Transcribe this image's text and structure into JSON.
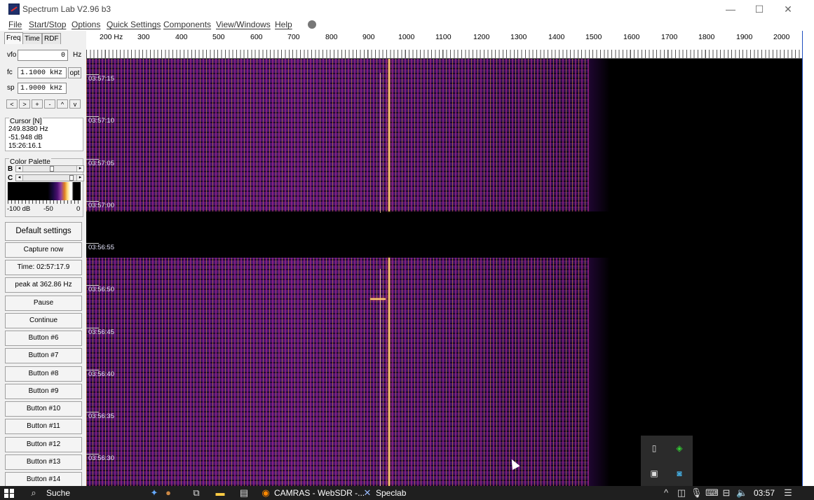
{
  "window": {
    "title": "Spectrum Lab V2.96 b3",
    "minimize": "—",
    "maximize": "☐",
    "close": "✕"
  },
  "menu": {
    "items": [
      "File",
      "Start/Stop",
      "Options",
      "Quick Settings",
      "Components",
      "View/Windows",
      "Help"
    ]
  },
  "tabs": [
    "Freq",
    "Time",
    "RDF"
  ],
  "vfo": {
    "label": "vfo",
    "value": "0",
    "unit": "Hz"
  },
  "fc": {
    "label": "fc",
    "value": "1.1000 kHz",
    "opt": "opt"
  },
  "sp": {
    "label": "sp",
    "value": "1.9000 kHz"
  },
  "nav_buttons": [
    "<",
    ">",
    "+",
    "-",
    "^",
    "v"
  ],
  "cursor": {
    "title": "Cursor [N]",
    "freq": "249.8380 Hz",
    "level": "-51.948 dB",
    "time": "15:26:16.1"
  },
  "palette": {
    "title": "Color Palette",
    "b_label": "B",
    "c_label": "C",
    "min": "-100 dB",
    "mid": "-50",
    "max": "0"
  },
  "buttons": [
    "Default settings",
    "Capture now",
    "Time:  02:57:17.9",
    "peak at 362.86 Hz",
    "Pause",
    "Continue",
    "Button #6",
    "Button #7",
    "Button #8",
    "Button #9",
    "Button #10",
    "Button #11",
    "Button #12",
    "Button #13",
    "Button #14"
  ],
  "freq_scale": [
    "200 Hz",
    "300",
    "400",
    "500",
    "600",
    "700",
    "800",
    "900",
    "1000",
    "1100",
    "1200",
    "1300",
    "1400",
    "1500",
    "1600",
    "1700",
    "1800",
    "1900",
    "2000"
  ],
  "time_labels": [
    "03:57:15",
    "03:57:10",
    "03:57:05",
    "03:57:00",
    "03:56:55",
    "03:56:50",
    "03:56:45",
    "03:56:40",
    "03:56:35",
    "03:56:30"
  ],
  "taskbar": {
    "search": "Suche",
    "app1": "CAMRAS - WebSDR -...",
    "app2": "Speclab",
    "clock": "03:57"
  },
  "colors": {
    "background": "#000000",
    "signal": "#ffd070",
    "noise": "#3a1060"
  }
}
